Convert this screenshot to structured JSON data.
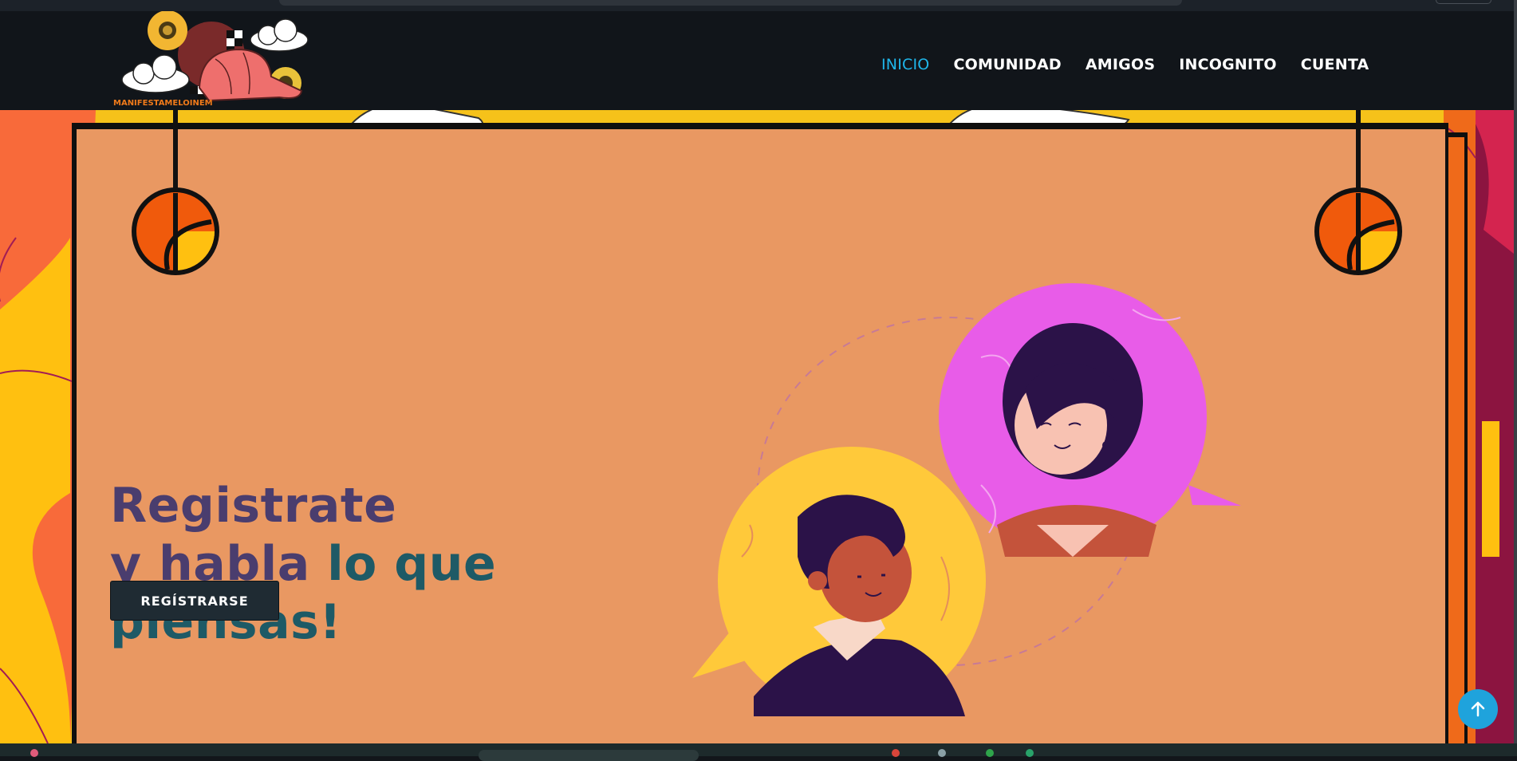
{
  "brand": {
    "logo_text": "MANIFESTAMELOINEM",
    "colors": {
      "navbar": "#11151a",
      "accent": "#1fb6ea",
      "panel": "#e99862",
      "button": "#1f2b33"
    }
  },
  "nav": {
    "items": [
      {
        "label": "INICIO",
        "active": true
      },
      {
        "label": "COMUNIDAD",
        "active": false
      },
      {
        "label": "AMIGOS",
        "active": false
      },
      {
        "label": "INCOGNITO",
        "active": false
      },
      {
        "label": "CUENTA",
        "active": false
      }
    ]
  },
  "hero": {
    "line1": "Registrate",
    "line2_a": "y habla",
    "line2_b": "lo que",
    "line3": "piensas!",
    "cta_label": "REGÍSTRARSE"
  },
  "icons": {
    "scroll_top": "arrow-up-icon",
    "lamps": "hanging-lamp-icon",
    "logo_art": "cap-sunflower-cloud-logo"
  }
}
